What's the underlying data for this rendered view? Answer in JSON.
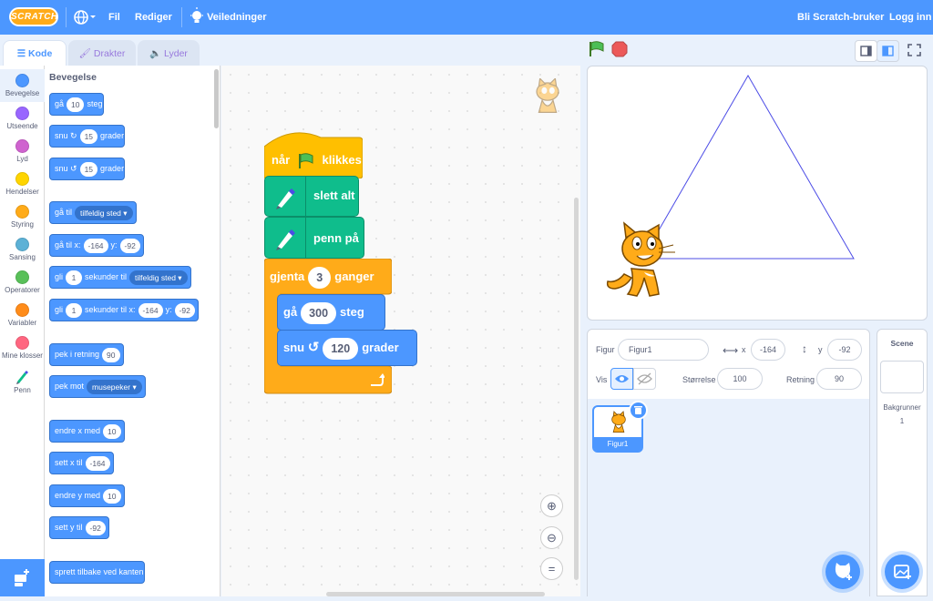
{
  "menubar": {
    "logo": "SCRATCH",
    "file": "Fil",
    "edit": "Rediger",
    "tutorials": "Veiledninger",
    "join": "Bli Scratch-bruker",
    "login": "Logg inn"
  },
  "tabs": {
    "code": "Kode",
    "costumes": "Drakter",
    "sounds": "Lyder"
  },
  "categories": [
    {
      "label": "Bevegelse",
      "color": "#4c97ff"
    },
    {
      "label": "Utseende",
      "color": "#9966ff"
    },
    {
      "label": "Lyd",
      "color": "#cf63cf"
    },
    {
      "label": "Hendelser",
      "color": "#ffd500"
    },
    {
      "label": "Styring",
      "color": "#ffab19"
    },
    {
      "label": "Sansing",
      "color": "#5cb1d6"
    },
    {
      "label": "Operatorer",
      "color": "#59c059"
    },
    {
      "label": "Variabler",
      "color": "#ff8c1a"
    },
    {
      "label": "Mine klosser",
      "color": "#ff6680"
    },
    {
      "label": "Penn",
      "color": "#0fbd8c"
    }
  ],
  "palette": {
    "heading": "Bevegelse",
    "move": {
      "a": "gå",
      "v": "10",
      "b": "steg"
    },
    "turn_right": {
      "a": "snu",
      "v": "15",
      "b": "grader"
    },
    "turn_left": {
      "a": "snu",
      "v": "15",
      "b": "grader"
    },
    "goto": {
      "a": "gå til",
      "d": "tilfeldig sted"
    },
    "goto_xy": {
      "a": "gå til x:",
      "x": "-164",
      "b": "y:",
      "y": "-92"
    },
    "glide": {
      "a": "gli",
      "v": "1",
      "b": "sekunder til",
      "d": "tilfeldig sted"
    },
    "glide_xy": {
      "a": "gli",
      "v": "1",
      "b": "sekunder til x:",
      "x": "-164",
      "c": "y:",
      "y": "-92"
    },
    "point_dir": {
      "a": "pek i retning",
      "v": "90"
    },
    "point_towards": {
      "a": "pek mot",
      "d": "musepeker"
    },
    "change_x": {
      "a": "endre x med",
      "v": "10"
    },
    "set_x": {
      "a": "sett x til",
      "v": "-164"
    },
    "change_y": {
      "a": "endre y med",
      "v": "10"
    },
    "set_y": {
      "a": "sett y til",
      "v": "-92"
    },
    "bounce": "sprett tilbake ved kanten"
  },
  "script": {
    "hat_a": "når",
    "hat_b": "klikkes",
    "clear": "slett alt",
    "pen_down": "penn på",
    "repeat_a": "gjenta",
    "repeat_v": "3",
    "repeat_b": "ganger",
    "move_a": "gå",
    "move_v": "300",
    "move_b": "steg",
    "turn_a": "snu",
    "turn_v": "120",
    "turn_b": "grader"
  },
  "sprite_info": {
    "sprite_label": "Figur",
    "sprite_name": "Figur1",
    "x_label": "x",
    "x": "-164",
    "y_label": "y",
    "y": "-92",
    "show_label": "Vis",
    "size_label": "Størrelse",
    "size": "100",
    "direction_label": "Retning",
    "direction": "90",
    "thumb_name": "Figur1"
  },
  "scene": {
    "title": "Scene",
    "backdrops_label": "Bakgrunner",
    "backdrops_count": "1"
  },
  "colors": {
    "motion": "#4c97ff",
    "pen": "#0fbd8c",
    "control": "#ffab19",
    "events": "#ffbf00",
    "menubar": "#4c97ff",
    "line": "#4c4ce6"
  }
}
